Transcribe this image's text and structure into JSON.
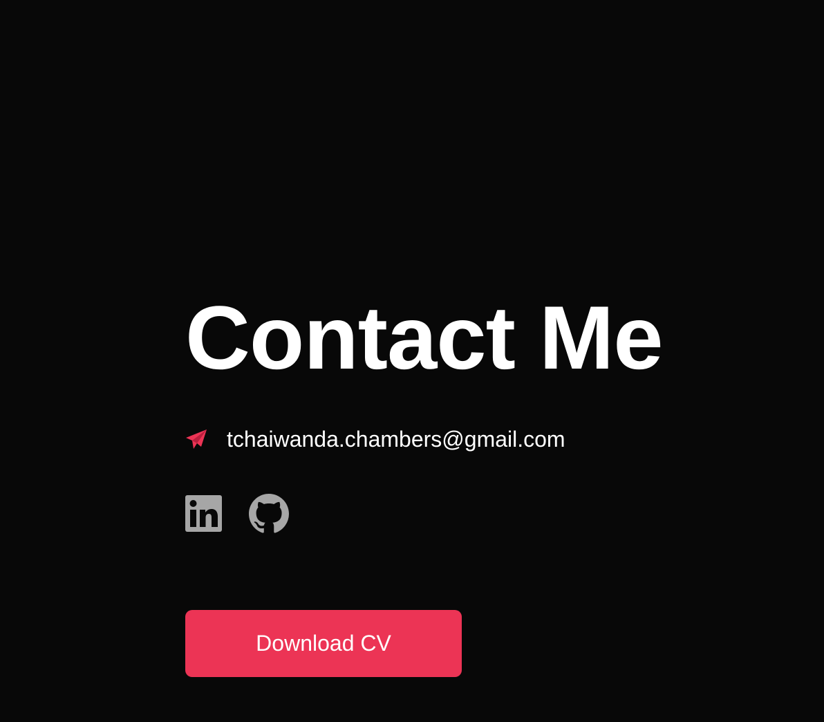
{
  "contact": {
    "title": "Contact Me",
    "email": "tchaiwanda.chambers@gmail.com",
    "email_icon": "paper-plane-icon",
    "social_links": [
      {
        "name": "LinkedIn",
        "icon": "linkedin-icon"
      },
      {
        "name": "GitHub",
        "icon": "github-icon"
      }
    ],
    "download_button_label": "Download CV"
  },
  "colors": {
    "background": "#080808",
    "text": "#ffffff",
    "accent": "#ec3455",
    "social_icon": "#a6a6a6"
  }
}
